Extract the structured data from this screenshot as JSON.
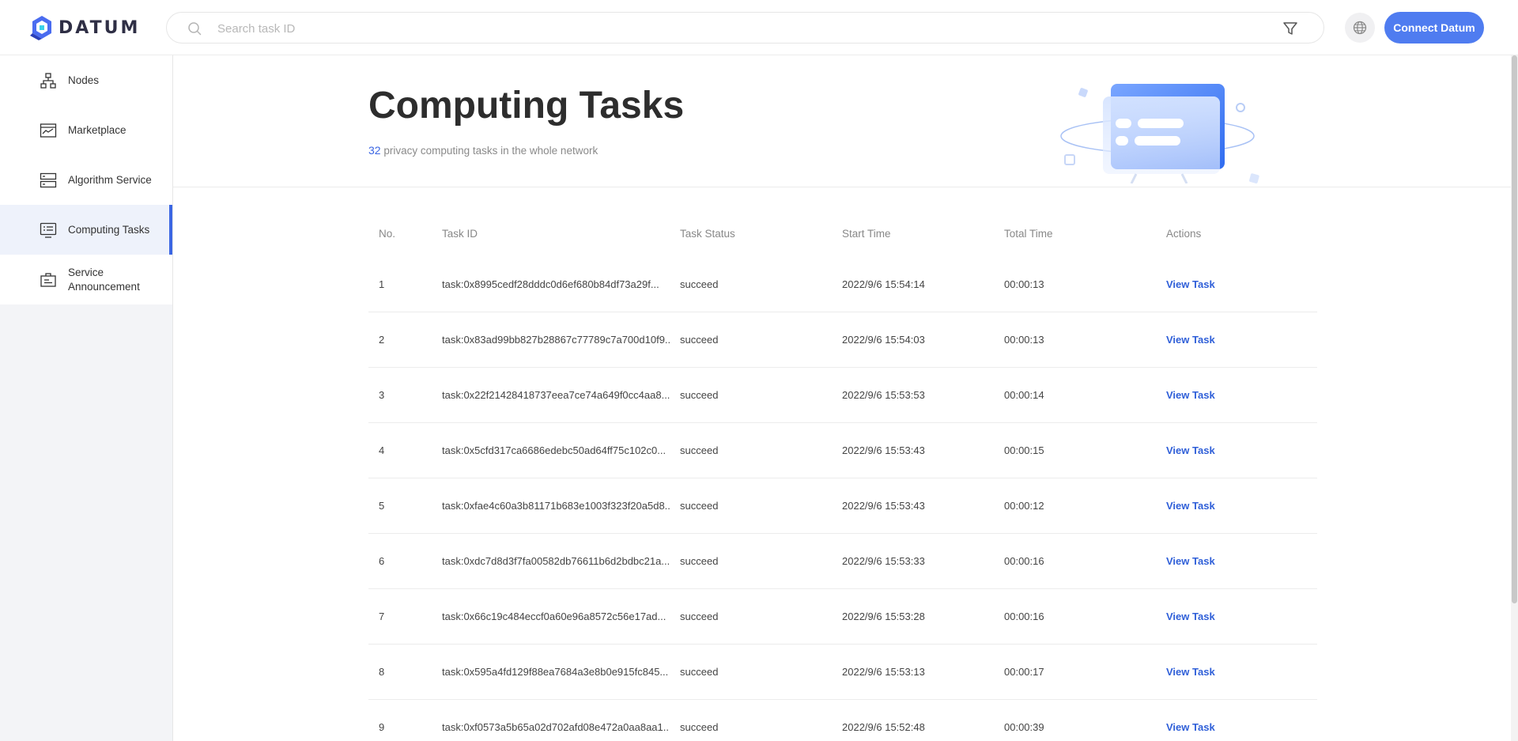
{
  "header": {
    "logo_text": "DATUM",
    "search_placeholder": "Search task ID",
    "connect_label": "Connect Datum",
    "icons": {
      "search": "search-icon",
      "filter": "filter-icon",
      "language": "globe-icon"
    },
    "accent_color": "#4f7cf0"
  },
  "sidebar": {
    "items": [
      {
        "label": "Nodes",
        "icon": "nodes-icon",
        "active": false
      },
      {
        "label": "Marketplace",
        "icon": "marketplace-icon",
        "active": false
      },
      {
        "label": "Algorithm Service",
        "icon": "algorithm-service-icon",
        "active": false
      },
      {
        "label": "Computing Tasks",
        "icon": "computing-tasks-icon",
        "active": true
      },
      {
        "label": "Service Announcement",
        "icon": "announcement-icon",
        "active": false
      }
    ],
    "active_color": "#3b66e3"
  },
  "main": {
    "title": "Computing Tasks",
    "count": "32",
    "subtitle_text": " privacy computing tasks in the whole network",
    "table": {
      "headers": [
        "No.",
        "Task ID",
        "Task Status",
        "Start Time",
        "Total Time",
        "Actions"
      ],
      "rows": [
        {
          "no": "1",
          "task_id": "task:0x8995cedf28dddc0d6ef680b84df73a29f...",
          "status": "succeed",
          "start": "2022/9/6 15:54:14",
          "total": "00:00:13",
          "action": "View Task"
        },
        {
          "no": "2",
          "task_id": "task:0x83ad99bb827b28867c77789c7a700d10f9...",
          "status": "succeed",
          "start": "2022/9/6 15:54:03",
          "total": "00:00:13",
          "action": "View Task"
        },
        {
          "no": "3",
          "task_id": "task:0x22f21428418737eea7ce74a649f0cc4aa8...",
          "status": "succeed",
          "start": "2022/9/6 15:53:53",
          "total": "00:00:14",
          "action": "View Task"
        },
        {
          "no": "4",
          "task_id": "task:0x5cfd317ca6686edebc50ad64ff75c102c0...",
          "status": "succeed",
          "start": "2022/9/6 15:53:43",
          "total": "00:00:15",
          "action": "View Task"
        },
        {
          "no": "5",
          "task_id": "task:0xfae4c60a3b81171b683e1003f323f20a5d8...",
          "status": "succeed",
          "start": "2022/9/6 15:53:43",
          "total": "00:00:12",
          "action": "View Task"
        },
        {
          "no": "6",
          "task_id": "task:0xdc7d8d3f7fa00582db76611b6d2bdbc21a...",
          "status": "succeed",
          "start": "2022/9/6 15:53:33",
          "total": "00:00:16",
          "action": "View Task"
        },
        {
          "no": "7",
          "task_id": "task:0x66c19c484eccf0a60e96a8572c56e17ad...",
          "status": "succeed",
          "start": "2022/9/6 15:53:28",
          "total": "00:00:16",
          "action": "View Task"
        },
        {
          "no": "8",
          "task_id": "task:0x595a4fd129f88ea7684a3e8b0e915fc845...",
          "status": "succeed",
          "start": "2022/9/6 15:53:13",
          "total": "00:00:17",
          "action": "View Task"
        },
        {
          "no": "9",
          "task_id": "task:0xf0573a5b65a02d702afd08e472a0aa8aa1...",
          "status": "succeed",
          "start": "2022/9/6 15:52:48",
          "total": "00:00:39",
          "action": "View Task"
        }
      ]
    },
    "link_color": "#2f5fd8"
  }
}
